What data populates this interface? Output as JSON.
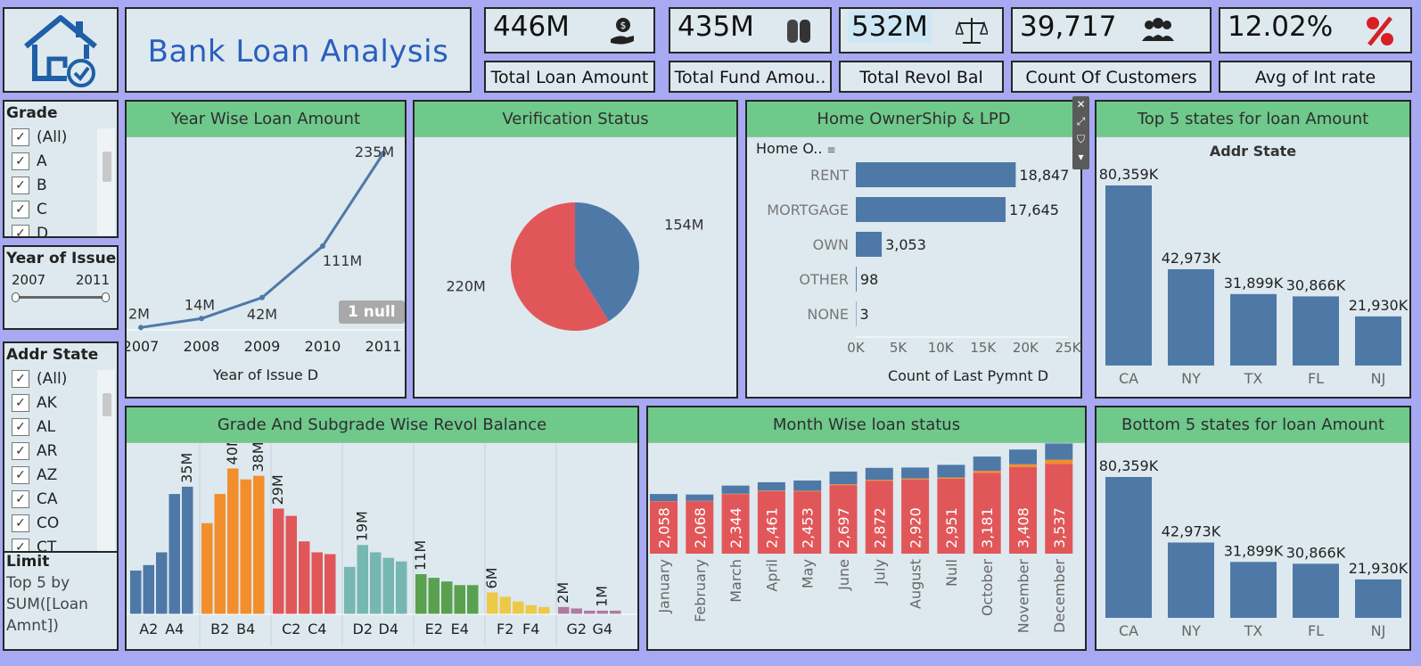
{
  "title": "Bank Loan Analysis",
  "kpis": [
    {
      "value": "446M",
      "label": "Total Loan Amount",
      "icon": "money-hand-icon"
    },
    {
      "value": "435M",
      "label": "Total Fund Amou..",
      "icon": "coins-icon"
    },
    {
      "value": "532M",
      "label": "Total Revol Bal",
      "icon": "scale-icon"
    },
    {
      "value": "39,717",
      "label": "Count Of Customers",
      "icon": "people-icon"
    },
    {
      "value": "12.02%",
      "label": "Avg of Int rate",
      "icon": "percent-icon"
    }
  ],
  "filters": {
    "grade": {
      "title": "Grade",
      "items": [
        "(All)",
        "A",
        "B",
        "C",
        "D"
      ]
    },
    "year": {
      "title": "Year of Issue D",
      "min": "2007",
      "max": "2011"
    },
    "state": {
      "title": "Addr State",
      "items": [
        "(All)",
        "AK",
        "AL",
        "AR",
        "AZ",
        "CA",
        "CO",
        "CT"
      ]
    },
    "limit": {
      "title": "Limit",
      "text": "Top 5 by SUM([Loan Amnt])"
    }
  },
  "charts": {
    "year_wise": {
      "title": "Year Wise Loan Amount",
      "xlabel": "Year of Issue D",
      "null_badge": "1 null"
    },
    "verification": {
      "title": "Verification Status"
    },
    "home": {
      "title": "Home OwnerShip & LPD",
      "ylabel": "Home O..",
      "xlabel": "Count of Last Pymnt D"
    },
    "top5": {
      "title": "Top 5 states for loan Amount",
      "subtitle": "Addr State"
    },
    "grade_sub": {
      "title": "Grade And Subgrade Wise Revol Balance"
    },
    "month": {
      "title": "Month Wise loan status"
    },
    "bottom5": {
      "title": "Bottom 5 states for loan Amount"
    }
  },
  "chart_data": [
    {
      "type": "line",
      "title": "Year Wise Loan Amount",
      "xlabel": "Year of Issue D",
      "x": [
        "2007",
        "2008",
        "2009",
        "2010",
        "2011"
      ],
      "values": [
        2,
        14,
        42,
        111,
        235
      ],
      "labels": [
        "2M",
        "14M",
        "42M",
        "111M",
        "235M"
      ],
      "color": "#4e79a7"
    },
    {
      "type": "pie",
      "title": "Verification Status",
      "values": [
        154,
        220
      ],
      "labels": [
        "154M",
        "220M"
      ],
      "colors": [
        "#4e79a7",
        "#e15759"
      ]
    },
    {
      "type": "bar",
      "orientation": "horizontal",
      "title": "Home OwnerShip & LPD",
      "xlabel": "Count of Last Pymnt D",
      "categories": [
        "RENT",
        "MORTGAGE",
        "OWN",
        "OTHER",
        "NONE"
      ],
      "values": [
        18847,
        17645,
        3053,
        98,
        3
      ],
      "labels": [
        "18,847",
        "17,645",
        "3,053",
        "98",
        "3"
      ],
      "ticks": [
        "0K",
        "5K",
        "10K",
        "15K",
        "20K",
        "25K"
      ],
      "xlim": [
        0,
        25000
      ],
      "color": "#4e79a7"
    },
    {
      "type": "bar",
      "title": "Top 5 states for loan Amount",
      "xlabel": "Addr State",
      "categories": [
        "CA",
        "NY",
        "TX",
        "FL",
        "NJ"
      ],
      "values": [
        80359,
        42973,
        31899,
        30866,
        21930
      ],
      "labels": [
        "80,359K",
        "42,973K",
        "31,899K",
        "30,866K",
        "21,930K"
      ],
      "color": "#4e79a7"
    },
    {
      "type": "bar",
      "title": "Grade And Subgrade Wise Revol Balance",
      "groups": [
        {
          "color": "#4e79a7",
          "values": [
            12,
            13.5,
            17,
            33,
            35
          ],
          "ticks": [
            "A2",
            "A4"
          ],
          "label": "35M",
          "label_index": 4
        },
        {
          "color": "#f28e2b",
          "values": [
            25,
            33,
            40,
            37,
            38
          ],
          "ticks": [
            "B2",
            "B4"
          ],
          "label": "40M",
          "label_index": 2,
          "label2": "38M",
          "label2_index": 4
        },
        {
          "color": "#e15759",
          "values": [
            29,
            27,
            20,
            17,
            16.5
          ],
          "ticks": [
            "C2",
            "C4"
          ],
          "label": "29M",
          "label_index": 0
        },
        {
          "color": "#76b7b2",
          "values": [
            13,
            19,
            17,
            15.5,
            14.5
          ],
          "ticks": [
            "D2",
            "D4"
          ],
          "label": "19M",
          "label_index": 1
        },
        {
          "color": "#59a14f",
          "values": [
            11,
            10,
            9,
            8,
            8
          ],
          "ticks": [
            "E2",
            "E4"
          ],
          "label": "11M",
          "label_index": 0
        },
        {
          "color": "#edc948",
          "values": [
            6,
            4.8,
            3.5,
            2.5,
            2
          ],
          "ticks": [
            "F2",
            "F4"
          ],
          "label": "6M",
          "label_index": 0
        },
        {
          "color": "#b07aa1",
          "values": [
            2,
            1.6,
            1,
            1,
            1
          ],
          "ticks": [
            "G2",
            "G4"
          ],
          "label": "2M",
          "label_index": 0,
          "label2": "1M",
          "label2_index": 3
        }
      ],
      "ylim": [
        0,
        45
      ]
    },
    {
      "type": "bar",
      "stacked": true,
      "title": "Month Wise loan status",
      "categories": [
        "January",
        "February",
        "March",
        "April",
        "May",
        "June",
        "July",
        "August",
        "Null",
        "October",
        "November",
        "December"
      ],
      "series": [
        {
          "name": "",
          "color": "#e15759",
          "values": [
            2058,
            2068,
            2344,
            2461,
            2453,
            2697,
            2872,
            2920,
            2951,
            3181,
            3408,
            3537
          ]
        },
        {
          "name": "",
          "color": "#f28e2b",
          "values": [
            10,
            10,
            15,
            20,
            25,
            35,
            35,
            40,
            45,
            80,
            110,
            160
          ]
        },
        {
          "name": "",
          "color": "#4e79a7",
          "values": [
            280,
            250,
            320,
            330,
            400,
            500,
            470,
            430,
            500,
            560,
            580,
            640
          ]
        }
      ],
      "labels": [
        "2,058",
        "2,068",
        "2,344",
        "2,461",
        "2,453",
        "2,697",
        "2,872",
        "2,920",
        "2,951",
        "3,181",
        "3,408",
        "3,537"
      ]
    },
    {
      "type": "bar",
      "title": "Bottom 5 states for loan Amount",
      "categories": [
        "CA",
        "NY",
        "TX",
        "FL",
        "NJ"
      ],
      "values": [
        80359,
        42973,
        31899,
        30866,
        21930
      ],
      "labels": [
        "80,359K",
        "42,973K",
        "31,899K",
        "30,866K",
        "21,930K"
      ],
      "color": "#4e79a7"
    }
  ]
}
